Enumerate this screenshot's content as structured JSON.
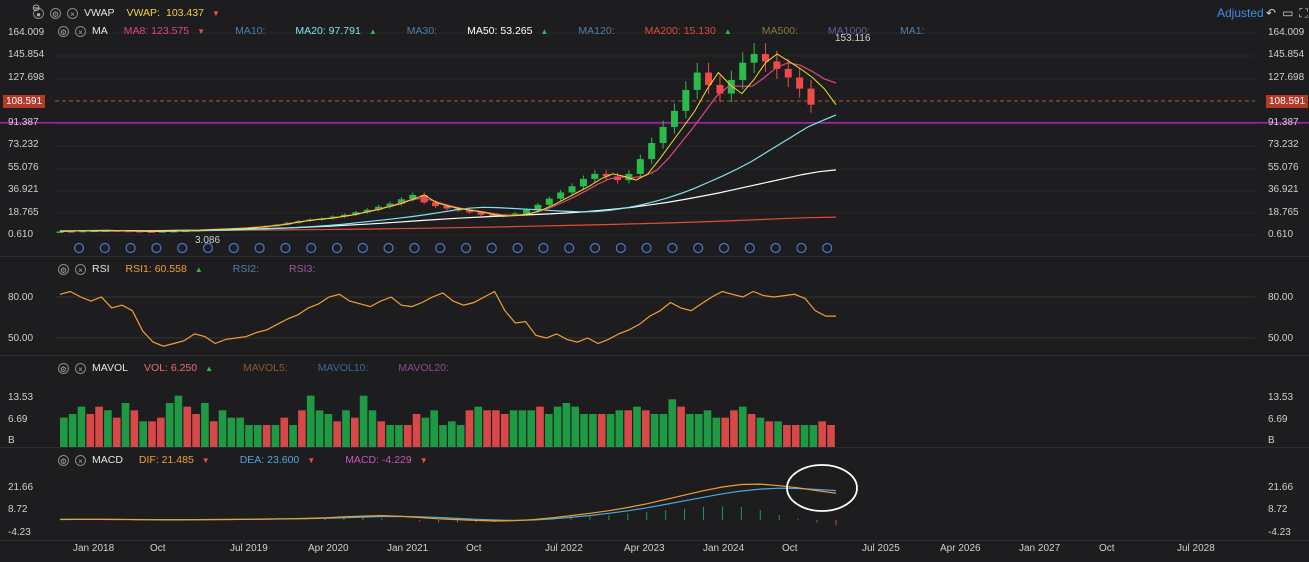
{
  "toolbar": {
    "adjusted_label": "Adjusted"
  },
  "vwap": {
    "name": "VWAP",
    "label": "VWAP:",
    "value": "103.437",
    "arrow": "▼"
  },
  "ma": {
    "name": "MA",
    "items": [
      {
        "text": "MA8: 123.575",
        "arrow": "▼",
        "color": "#e0457b"
      },
      {
        "text": "MA10:",
        "arrow": "",
        "color": "#4e7fa8"
      },
      {
        "text": "MA20: 97.791",
        "arrow": "▲",
        "color": "#7fe3f0"
      },
      {
        "text": "MA30:",
        "arrow": "",
        "color": "#4e7fa8"
      },
      {
        "text": "MA50: 53.265",
        "arrow": "▲",
        "color": "#ffffff"
      },
      {
        "text": "MA120:",
        "arrow": "",
        "color": "#4e7fa8"
      },
      {
        "text": "MA200: 15.130",
        "arrow": "▲",
        "color": "#e04a3a"
      },
      {
        "text": "MA500:",
        "arrow": "",
        "color": "#8a7a3a"
      },
      {
        "text": "MA1000:",
        "arrow": "",
        "color": "#6a5a9a"
      },
      {
        "text": "MA1:",
        "arrow": "",
        "color": "#4e7fa8"
      }
    ]
  },
  "rsi": {
    "name": "RSI",
    "items": [
      {
        "text": "RSI1: 60.558",
        "arrow": "▲",
        "color": "#f0a030"
      },
      {
        "text": "RSI2:",
        "arrow": "",
        "color": "#4e7fa8"
      },
      {
        "text": "RSI3:",
        "arrow": "",
        "color": "#9a5aa0"
      }
    ]
  },
  "mavol": {
    "name": "MAVOL",
    "items": [
      {
        "text": "VOL: 6.250",
        "arrow": "▲",
        "color": "#f06a6a"
      },
      {
        "text": "MAVOL5:",
        "arrow": "",
        "color": "#8a5a2a"
      },
      {
        "text": "MAVOL10:",
        "arrow": "",
        "color": "#3a6a9a"
      },
      {
        "text": "MAVOL20:",
        "arrow": "",
        "color": "#8a4a8a"
      }
    ]
  },
  "macd": {
    "name": "MACD",
    "items": [
      {
        "text": "DIF: 21.485",
        "arrow": "▼",
        "color": "#f0a030"
      },
      {
        "text": "DEA: 23.600",
        "arrow": "▼",
        "color": "#4aa8e0"
      },
      {
        "text": "MACD: -4.229",
        "arrow": "▼",
        "color": "#d050c0"
      }
    ]
  },
  "price_axis": [
    "164.009",
    "145.854",
    "127.698",
    "91.387",
    "73.232",
    "55.076",
    "36.921",
    "18.765",
    "0.610"
  ],
  "last_price": "108.591",
  "annotations": {
    "high": "153.116",
    "low": "3.086"
  },
  "rsi_axis": [
    "80.00",
    "50.00"
  ],
  "vol_axis": [
    "13.53",
    "6.69",
    "B"
  ],
  "macd_axis": [
    "21.66",
    "8.72",
    "-4.23"
  ],
  "x_labels": [
    "Jan 2018",
    "Oct",
    "Jul 2019",
    "Apr 2020",
    "Jan 2021",
    "Oct",
    "Jul 2022",
    "Apr 2023",
    "Jan 2024",
    "Oct",
    "Jul 2025",
    "Apr 2026",
    "Jan 2027",
    "Oct",
    "Jul 2028"
  ],
  "colors": {
    "up": "#2bbb4a",
    "down": "#f04a4a",
    "purple_line": "#b020b0",
    "rsi": "#f0a030",
    "dif": "#f0a030",
    "dea": "#4aa8e0"
  },
  "chart_data": {
    "type": "candlestick",
    "title": "",
    "x_labels": [
      "Jan 2018",
      "Oct",
      "Jul 2019",
      "Apr 2020",
      "Jan 2021",
      "Oct",
      "Jul 2022",
      "Apr 2023",
      "Jan 2024",
      "Oct"
    ],
    "price_range": [
      0.61,
      164.009
    ],
    "price_close": [
      3.5,
      3.8,
      4.0,
      4.2,
      4.4,
      4.1,
      3.9,
      3.6,
      3.4,
      3.7,
      3.9,
      4.2,
      4.6,
      5.0,
      5.4,
      5.8,
      6.2,
      6.9,
      7.8,
      8.9,
      10.5,
      12.0,
      13.2,
      14.0,
      15.5,
      17.0,
      19.0,
      21.0,
      23.5,
      26.0,
      29.5,
      33.0,
      27.0,
      24.0,
      22.0,
      20.5,
      19.0,
      17.0,
      16.0,
      16.5,
      18.0,
      21.0,
      25.0,
      30.0,
      35.0,
      40.0,
      46.0,
      50.0,
      48.0,
      45.0,
      50.0,
      62.0,
      75.0,
      88.0,
      101.0,
      118.0,
      132.0,
      122.0,
      115.0,
      126.0,
      140.0,
      147.0,
      141.0,
      135.0,
      128.0,
      119.0,
      106.0
    ],
    "horizontal_line": 91.387,
    "ma": {
      "MA8": [
        3.6,
        3.9,
        4.1,
        4.3,
        4.3,
        4.1,
        3.8,
        3.6,
        3.6,
        3.8,
        4.0,
        4.4,
        4.8,
        5.2,
        5.6,
        6.0,
        6.6,
        7.4,
        8.4,
        9.6,
        11.2,
        12.6,
        13.6,
        14.6,
        16.0,
        17.8,
        20.0,
        22.4,
        25.0,
        28.0,
        30.0,
        29.0,
        26.0,
        23.5,
        21.5,
        20.0,
        18.5,
        17.0,
        16.6,
        17.4,
        19.3,
        22.5,
        26.5,
        31.0,
        36.0,
        41.5,
        46.0,
        47.5,
        47.0,
        48.5,
        53.0,
        63.0,
        75.0,
        87.0,
        100.0,
        113.0,
        121.0,
        121.0,
        121.0,
        128.0,
        136.0,
        140.0,
        138.0,
        133.0,
        127.0,
        123.6
      ],
      "MA20": [
        3.8,
        3.9,
        4.0,
        4.1,
        4.1,
        4.0,
        3.9,
        3.8,
        3.8,
        3.9,
        4.1,
        4.3,
        4.6,
        4.9,
        5.3,
        5.7,
        6.2,
        6.8,
        7.5,
        8.3,
        9.3,
        10.5,
        11.7,
        12.9,
        14.2,
        15.6,
        17.2,
        19.0,
        20.8,
        22.3,
        23.0,
        22.8,
        22.1,
        21.5,
        21.0,
        20.3,
        19.7,
        19.4,
        19.6,
        20.6,
        22.3,
        24.5,
        27.2,
        30.4,
        34.2,
        38.5,
        43.5,
        48.5,
        54.0,
        60.0,
        67.0,
        74.0,
        81.0,
        88.0,
        93.0,
        97.8
      ],
      "MA50": [
        4.0,
        4.0,
        4.0,
        4.0,
        4.1,
        4.1,
        4.2,
        4.3,
        4.5,
        4.7,
        5.0,
        5.3,
        5.7,
        6.1,
        6.6,
        7.2,
        7.8,
        8.5,
        9.3,
        10.1,
        11.0,
        11.9,
        12.8,
        13.7,
        14.5,
        15.2,
        15.9,
        16.5,
        17.1,
        17.7,
        18.4,
        19.3,
        20.4,
        21.7,
        23.2,
        25.0,
        27.0,
        29.3,
        31.8,
        34.5,
        37.5,
        40.5,
        43.5,
        46.5,
        49.5,
        51.8,
        53.3
      ],
      "MA200": [
        4.0,
        4.0,
        4.1,
        4.1,
        4.2,
        4.3,
        4.4,
        4.5,
        4.7,
        4.9,
        5.1,
        5.4,
        5.7,
        6.0,
        6.4,
        6.8,
        7.2,
        7.7,
        8.2,
        8.7,
        9.2,
        9.8,
        10.4,
        11.1,
        11.9,
        12.8,
        13.8,
        14.6,
        15.1
      ]
    },
    "rsi_axis": [
      50,
      80
    ],
    "rsi": [
      82,
      84,
      80,
      77,
      80,
      72,
      74,
      70,
      55,
      47,
      44,
      46,
      48,
      53,
      51,
      46,
      49,
      50,
      51,
      54,
      56,
      60,
      64,
      67,
      72,
      75,
      80,
      82,
      77,
      75,
      73,
      77,
      80,
      74,
      73,
      76,
      80,
      83,
      77,
      74,
      76,
      80,
      84,
      70,
      61,
      62,
      52,
      50,
      53,
      49,
      47,
      50,
      46,
      49,
      53,
      56,
      60,
      66,
      70,
      76,
      72,
      70,
      75,
      80,
      84,
      82,
      80,
      84,
      81,
      80,
      81,
      82,
      79,
      70,
      66,
      66
    ],
    "volume_axis": [
      6.69,
      13.53
    ],
    "volume_up": [
      true,
      true,
      true,
      false,
      false,
      true,
      false,
      true,
      false,
      true,
      false,
      false,
      true,
      true,
      false,
      false,
      true,
      false,
      true,
      true,
      true,
      true,
      true,
      false,
      true,
      false,
      true,
      false,
      true,
      true,
      true,
      false,
      true,
      false,
      true,
      true,
      false,
      true,
      true,
      false,
      false,
      true,
      true,
      true,
      true,
      true,
      false,
      true,
      false,
      false,
      false,
      true,
      true,
      true,
      false,
      true,
      true,
      true,
      true,
      true,
      true,
      false,
      true,
      true,
      false,
      true,
      false,
      true,
      true,
      true,
      false,
      true
    ],
    "volume": [
      8,
      9,
      11,
      9,
      11,
      10,
      8,
      12,
      10,
      7,
      7,
      8,
      12,
      14,
      11,
      9,
      12,
      7,
      10,
      8,
      8,
      6,
      6,
      6,
      6,
      8,
      6,
      10,
      14,
      10,
      9,
      7,
      10,
      8,
      14,
      10,
      7,
      6,
      6,
      6,
      9,
      8,
      10,
      6,
      7,
      6,
      10,
      11,
      10,
      10,
      9,
      10,
      10,
      10,
      11,
      9,
      11,
      12,
      11,
      9,
      9,
      9,
      9,
      10,
      10,
      11,
      10,
      9,
      9,
      13,
      11,
      9,
      9,
      10,
      8,
      8,
      10,
      11,
      9,
      8,
      7,
      7,
      6,
      6,
      6,
      6,
      7,
      6
    ],
    "macd_axis": [
      -4.23,
      8.72,
      21.66
    ],
    "dif": [
      0.5,
      0.6,
      0.5,
      0.4,
      0.3,
      0.2,
      0.1,
      0.2,
      0.3,
      0.4,
      0.6,
      0.8,
      1.0,
      1.3,
      1.8,
      2.5,
      3.1,
      3.5,
      3.0,
      2.0,
      1.0,
      0.3,
      -0.3,
      -0.8,
      -0.6,
      0.3,
      1.8,
      3.5,
      5.4,
      7.5,
      10.0,
      13.0,
      16.5,
      20.0,
      23.5,
      26.5,
      28.5,
      28.8,
      27.5,
      25.8,
      23.5,
      21.5
    ],
    "dea": [
      0.4,
      0.5,
      0.5,
      0.5,
      0.4,
      0.3,
      0.3,
      0.3,
      0.4,
      0.5,
      0.6,
      0.7,
      0.9,
      1.1,
      1.4,
      1.8,
      2.3,
      2.8,
      2.9,
      2.6,
      2.0,
      1.3,
      0.6,
      0.0,
      -0.3,
      0.0,
      0.9,
      2.1,
      3.6,
      5.4,
      7.4,
      9.8,
      12.5,
      15.4,
      18.2,
      21.0,
      23.3,
      24.8,
      25.5,
      25.3,
      24.5,
      23.6
    ]
  }
}
